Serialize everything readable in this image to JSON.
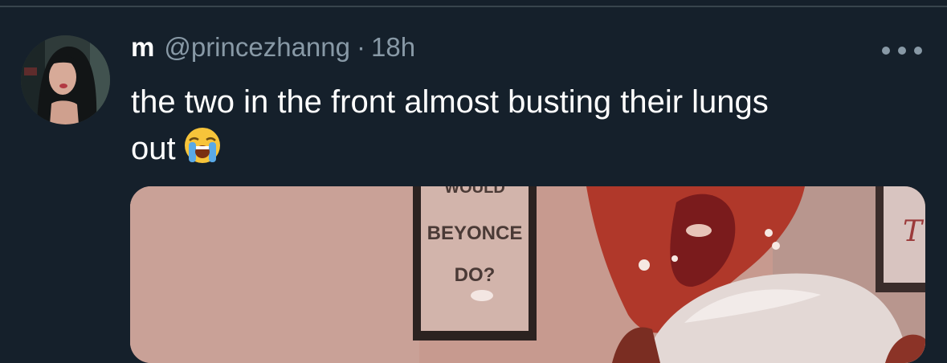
{
  "tweet": {
    "display_name": "m",
    "handle": "@princezhanng",
    "separator": "·",
    "time": "18h",
    "text_line1": "the two in the front almost busting their lungs",
    "text_line2": "out",
    "emoji": "loudly-crying-face"
  },
  "media": {
    "poster_text": [
      "WOULD",
      "BEYONCE",
      "DO?"
    ]
  },
  "colors": {
    "background": "#15202b",
    "secondary_text": "#8899a6",
    "primary_text": "#ffffff"
  }
}
